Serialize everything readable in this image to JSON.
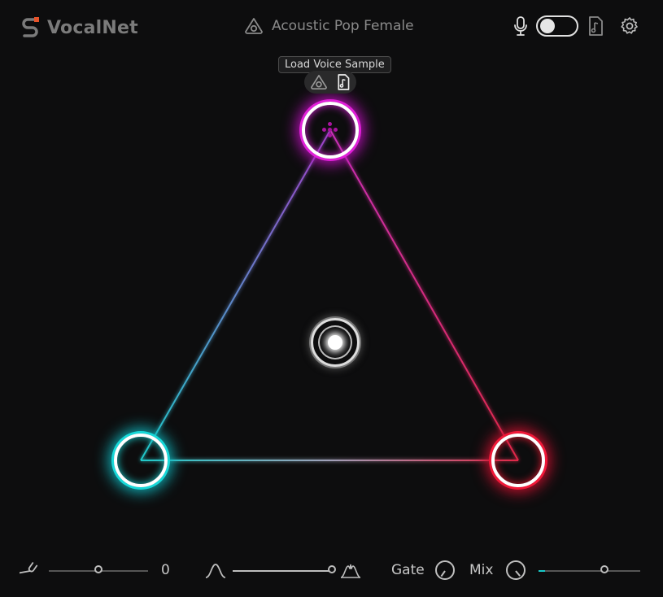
{
  "app": {
    "name": "VocalNet",
    "accent": "#e8532a"
  },
  "header": {
    "preset_name": "Acoustic Pop Female",
    "icons": [
      "preset-library-icon",
      "microphone-icon",
      "music-file-icon",
      "gear-icon"
    ],
    "toggle_on": false
  },
  "tooltip": {
    "text": "Load Voice Sample"
  },
  "nodes": {
    "top": {
      "color": "#e020d8"
    },
    "left": {
      "color": "#18d8d8"
    },
    "right": {
      "color": "#f01838"
    }
  },
  "footer": {
    "pitch_value": "0",
    "pitch_position": 0.5,
    "width_position": 1.0,
    "gate_label": "Gate",
    "mix_label": "Mix",
    "mix_position": 0.65
  }
}
